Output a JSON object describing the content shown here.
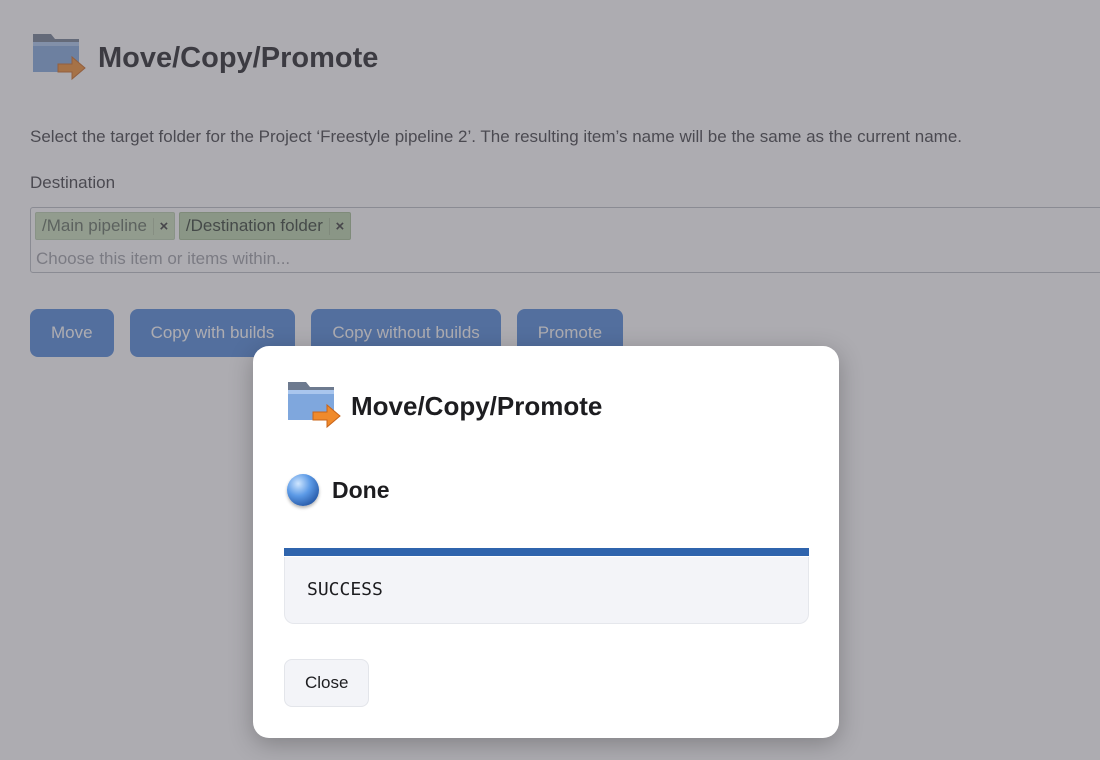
{
  "page": {
    "title": "Move/Copy/Promote",
    "description": "Select the target folder for the Project ‘Freestyle pipeline 2’. The resulting item’s name will be the same as the current name.",
    "destination_label": "Destination",
    "chips": [
      {
        "label": "/Main pipeline",
        "remove": "×"
      },
      {
        "label": "/Destination folder",
        "remove": "×"
      }
    ],
    "destination_placeholder": "Choose this item or items within...",
    "buttons": {
      "move": "Move",
      "copy_with_builds": "Copy with builds",
      "copy_without_builds": "Copy without builds",
      "promote": "Promote"
    }
  },
  "dialog": {
    "title": "Move/Copy/Promote",
    "status": "Done",
    "progress": 1.0,
    "console_output": "SUCCESS",
    "close_label": "Close"
  },
  "icons": {
    "folder": "folder-move-icon",
    "status": "blue-ball-status-icon"
  },
  "colors": {
    "primary_button": "#4a84d8",
    "progress_bar": "#2f64ad",
    "chip_green": "#c9dfb8"
  }
}
